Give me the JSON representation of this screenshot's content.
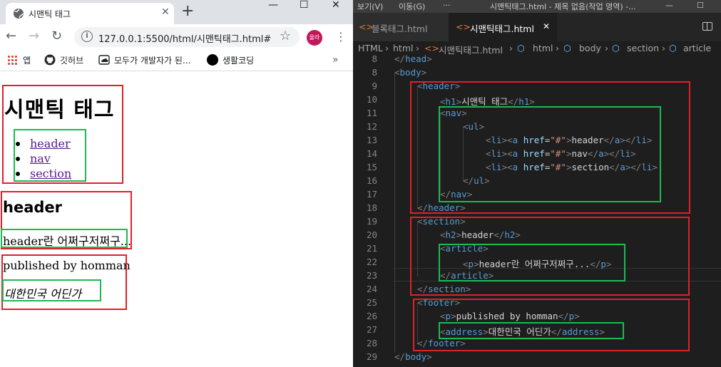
{
  "browser": {
    "tab_title": "시맨틱 태그",
    "tab_close": "✕",
    "new_tab": "+",
    "window_controls": [
      "—",
      "☐",
      "✕"
    ],
    "nav": {
      "back": "←",
      "forward": "→",
      "reload": "↻"
    },
    "url": "127.0.0.1:5500/html/시맨틱태그.html#",
    "avatar_text": "울라",
    "bookmarks": [
      {
        "label": "앱",
        "icon": "apps-grid-icon"
      },
      {
        "label": "깃허브",
        "icon": "github-icon"
      },
      {
        "label": "모두가 개발자가 된...",
        "icon": "cloud-icon"
      },
      {
        "label": "생활코딩",
        "icon": "circle-icon"
      }
    ],
    "bookmarks_more": "»",
    "page": {
      "h1": "시맨틱 태그",
      "nav_links": [
        "header",
        "nav",
        "section"
      ],
      "h2": "header",
      "article_p": "header란 어쩌구저쩌구...",
      "footer_p": "published by homman",
      "address": "대한민국 어딘가"
    }
  },
  "editor": {
    "menu": [
      "보기(V)",
      "이동(G)",
      "···",
      "시맨틱태그.html - 제목 없음(작업 영역) -..."
    ],
    "window_controls": [
      "—",
      "☐"
    ],
    "tabs": [
      {
        "label": "블록태그.html",
        "active": false
      },
      {
        "label": "시맨틱태그.html",
        "active": true,
        "close": "✕"
      }
    ],
    "breadcrumbs": [
      "HTML",
      "html",
      "시맨틱태그.html",
      "html",
      "body",
      "section",
      "article"
    ],
    "lines": [
      {
        "n": "8",
        "indent": 0,
        "tokens": [
          [
            "br",
            "</"
          ],
          [
            "tg",
            "head"
          ],
          [
            "br",
            ">"
          ]
        ]
      },
      {
        "n": "8",
        "indent": 0,
        "tokens": [
          [
            "br",
            "<"
          ],
          [
            "tg",
            "body"
          ],
          [
            "br",
            ">"
          ]
        ]
      },
      {
        "n": "9",
        "indent": 1,
        "tokens": [
          [
            "br",
            "<"
          ],
          [
            "tg",
            "header"
          ],
          [
            "br",
            ">"
          ]
        ]
      },
      {
        "n": "10",
        "indent": 2,
        "tokens": [
          [
            "br",
            "<"
          ],
          [
            "tg",
            "h1"
          ],
          [
            "br",
            ">"
          ],
          [
            "tx",
            "시맨틱 태그"
          ],
          [
            "br",
            "</"
          ],
          [
            "tg",
            "h1"
          ],
          [
            "br",
            ">"
          ]
        ]
      },
      {
        "n": "11",
        "indent": 2,
        "tokens": [
          [
            "br",
            "<"
          ],
          [
            "tg",
            "nav"
          ],
          [
            "br",
            ">"
          ]
        ]
      },
      {
        "n": "12",
        "indent": 3,
        "tokens": [
          [
            "br",
            "<"
          ],
          [
            "tg",
            "ul"
          ],
          [
            "br",
            ">"
          ]
        ]
      },
      {
        "n": "13",
        "indent": 4,
        "tokens": [
          [
            "br",
            "<"
          ],
          [
            "tg",
            "li"
          ],
          [
            "br",
            "><"
          ],
          [
            "tg",
            "a"
          ],
          [
            "tx",
            " "
          ],
          [
            "at",
            "href"
          ],
          [
            "tx",
            "="
          ],
          [
            "st",
            "\"#\""
          ],
          [
            "br",
            ">"
          ],
          [
            "tx",
            "header"
          ],
          [
            "br",
            "</"
          ],
          [
            "tg",
            "a"
          ],
          [
            "br",
            "></"
          ],
          [
            "tg",
            "li"
          ],
          [
            "br",
            ">"
          ]
        ]
      },
      {
        "n": "14",
        "indent": 4,
        "tokens": [
          [
            "br",
            "<"
          ],
          [
            "tg",
            "li"
          ],
          [
            "br",
            "><"
          ],
          [
            "tg",
            "a"
          ],
          [
            "tx",
            " "
          ],
          [
            "at",
            "href"
          ],
          [
            "tx",
            "="
          ],
          [
            "st",
            "\"#\""
          ],
          [
            "br",
            ">"
          ],
          [
            "tx",
            "nav"
          ],
          [
            "br",
            "</"
          ],
          [
            "tg",
            "a"
          ],
          [
            "br",
            "></"
          ],
          [
            "tg",
            "li"
          ],
          [
            "br",
            ">"
          ]
        ]
      },
      {
        "n": "15",
        "indent": 4,
        "tokens": [
          [
            "br",
            "<"
          ],
          [
            "tg",
            "li"
          ],
          [
            "br",
            "><"
          ],
          [
            "tg",
            "a"
          ],
          [
            "tx",
            " "
          ],
          [
            "at",
            "href"
          ],
          [
            "tx",
            "="
          ],
          [
            "st",
            "\"#\""
          ],
          [
            "br",
            ">"
          ],
          [
            "tx",
            "section"
          ],
          [
            "br",
            "</"
          ],
          [
            "tg",
            "a"
          ],
          [
            "br",
            "></"
          ],
          [
            "tg",
            "li"
          ],
          [
            "br",
            ">"
          ]
        ]
      },
      {
        "n": "16",
        "indent": 3,
        "tokens": [
          [
            "br",
            "</"
          ],
          [
            "tg",
            "ul"
          ],
          [
            "br",
            ">"
          ]
        ]
      },
      {
        "n": "17",
        "indent": 2,
        "tokens": [
          [
            "br",
            "</"
          ],
          [
            "tg",
            "nav"
          ],
          [
            "br",
            ">"
          ]
        ]
      },
      {
        "n": "18",
        "indent": 1,
        "tokens": [
          [
            "br",
            "</"
          ],
          [
            "tg",
            "header"
          ],
          [
            "br",
            ">"
          ]
        ]
      },
      {
        "n": "19",
        "indent": 1,
        "tokens": [
          [
            "br",
            "<"
          ],
          [
            "tg",
            "section"
          ],
          [
            "br",
            ">"
          ]
        ]
      },
      {
        "n": "20",
        "indent": 2,
        "tokens": [
          [
            "br",
            "<"
          ],
          [
            "tg",
            "h2"
          ],
          [
            "br",
            ">"
          ],
          [
            "tx",
            "header"
          ],
          [
            "br",
            "</"
          ],
          [
            "tg",
            "h2"
          ],
          [
            "br",
            ">"
          ]
        ]
      },
      {
        "n": "21",
        "indent": 2,
        "tokens": [
          [
            "br",
            "<"
          ],
          [
            "tg",
            "article"
          ],
          [
            "br",
            ">"
          ]
        ]
      },
      {
        "n": "22",
        "indent": 3,
        "tokens": [
          [
            "br",
            "<"
          ],
          [
            "tg",
            "p"
          ],
          [
            "br",
            ">"
          ],
          [
            "tx",
            "header란 어쩌구저쩌구..."
          ],
          [
            "br",
            "</"
          ],
          [
            "tg",
            "p"
          ],
          [
            "br",
            ">"
          ]
        ]
      },
      {
        "n": "23",
        "indent": 2,
        "tokens": [
          [
            "br",
            "</"
          ],
          [
            "tg",
            "article"
          ],
          [
            "br",
            ">"
          ]
        ]
      },
      {
        "n": "24",
        "indent": 1,
        "tokens": [
          [
            "br",
            "</"
          ],
          [
            "tg",
            "section"
          ],
          [
            "br",
            ">"
          ]
        ]
      },
      {
        "n": "25",
        "indent": 1,
        "tokens": [
          [
            "br",
            "<"
          ],
          [
            "tg",
            "footer"
          ],
          [
            "br",
            ">"
          ]
        ]
      },
      {
        "n": "26",
        "indent": 2,
        "tokens": [
          [
            "br",
            "<"
          ],
          [
            "tg",
            "p"
          ],
          [
            "br",
            ">"
          ],
          [
            "tx",
            "published by homman"
          ],
          [
            "br",
            "</"
          ],
          [
            "tg",
            "p"
          ],
          [
            "br",
            ">"
          ]
        ]
      },
      {
        "n": "27",
        "indent": 2,
        "tokens": [
          [
            "br",
            "<"
          ],
          [
            "tg",
            "address"
          ],
          [
            "br",
            ">"
          ],
          [
            "tx",
            "대한민국 어딘가"
          ],
          [
            "br",
            "</"
          ],
          [
            "tg",
            "address"
          ],
          [
            "br",
            ">"
          ]
        ]
      },
      {
        "n": "28",
        "indent": 1,
        "tokens": [
          [
            "br",
            "</"
          ],
          [
            "tg",
            "footer"
          ],
          [
            "br",
            ">"
          ]
        ]
      },
      {
        "n": "29",
        "indent": 0,
        "tokens": [
          [
            "br",
            "</"
          ],
          [
            "tg",
            "body"
          ],
          [
            "br",
            ">"
          ]
        ]
      }
    ]
  },
  "colors": {
    "annotation_red": "#e0202a",
    "annotation_green": "#1db954",
    "editor_bg": "#1e1e1e",
    "tag_blue": "#569cd6",
    "attr_lightblue": "#9cdcfe",
    "string_orange": "#ce9178",
    "visited_link": "#551a8b",
    "avatar_bg": "#c2185b"
  }
}
